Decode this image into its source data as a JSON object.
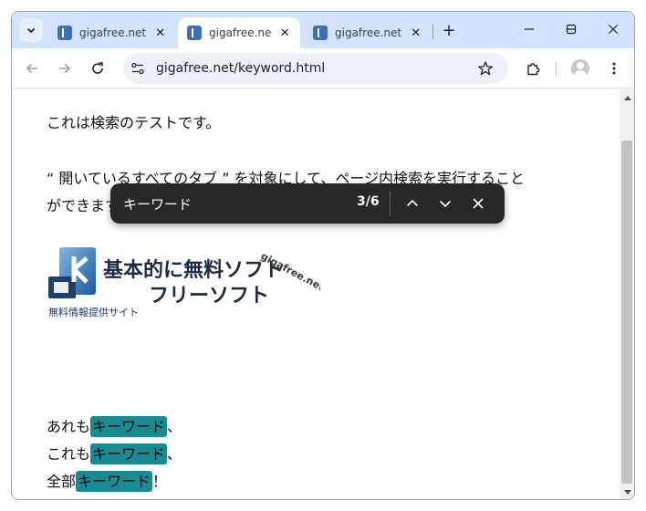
{
  "browser": {
    "tabs": [
      {
        "title": "gigafree.net/keyword.html",
        "active": false
      },
      {
        "title": "gigafree.net/keyword.html",
        "active": true
      },
      {
        "title": "gigafree.net/keyword.html",
        "active": false
      }
    ],
    "new_tab_label": "+",
    "address": {
      "url": "gigafree.net/keyword.html"
    },
    "colors": {
      "tabstrip": "#d3e3fd",
      "omnibox": "#edf2fa",
      "highlight": "#1a8a93",
      "findbar": "#282828"
    }
  },
  "page": {
    "line1": "これは検索のテストです。",
    "line2": "“ 開いているすべてのタブ ” を対象にして、ページ内検索を実行すること",
    "line3": "ができます",
    "logo": {
      "main": "基本的に無料ソフト",
      "sub_title": "フリーソフト",
      "brand": "gigafree.net",
      "tagline": "無料情報提供サイト"
    },
    "results": [
      {
        "prefix": "あれも",
        "match": "キーワード",
        "suffix": "、"
      },
      {
        "prefix": "これも",
        "match": "キーワード",
        "suffix": "、"
      },
      {
        "prefix": "全部",
        "match": "キーワード",
        "suffix": "！"
      }
    ]
  },
  "findbar": {
    "query": "キーワード",
    "count": "3/6",
    "icons": [
      "chevron-up-icon",
      "chevron-down-icon",
      "close-icon"
    ]
  }
}
